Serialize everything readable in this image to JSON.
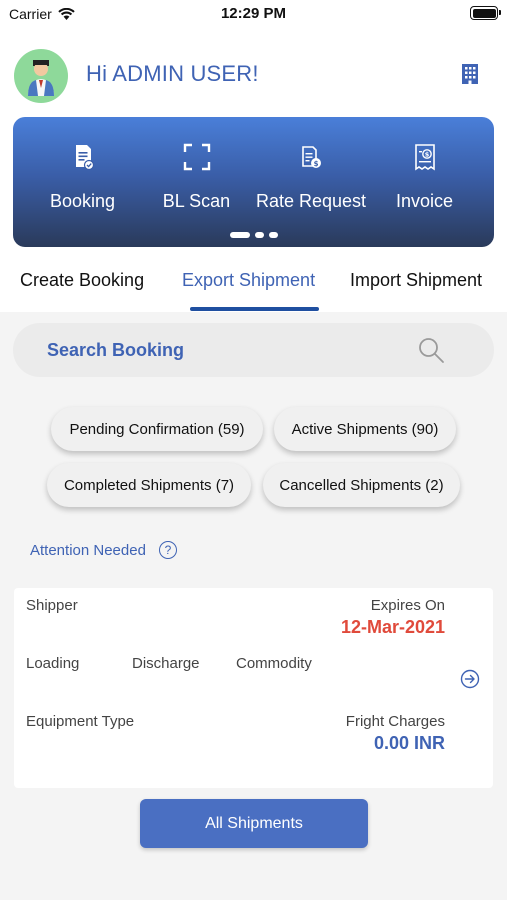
{
  "status_bar": {
    "carrier": "Carrier",
    "time": "12:29 PM"
  },
  "header": {
    "greeting": "Hi ADMIN USER!"
  },
  "quick_actions": [
    {
      "label": "Booking",
      "icon": "booking-document-icon"
    },
    {
      "label": "BL Scan",
      "icon": "scan-frame-icon"
    },
    {
      "label": "Rate Request",
      "icon": "rate-request-icon"
    },
    {
      "label": "Invoice",
      "icon": "invoice-icon"
    }
  ],
  "tabs": [
    {
      "label": "Create Booking",
      "active": false
    },
    {
      "label": "Export Shipment",
      "active": true
    },
    {
      "label": "Import Shipment",
      "active": false
    }
  ],
  "search": {
    "placeholder": "Search Booking"
  },
  "filters": [
    "Pending Confirmation (59)",
    "Active Shipments (90)",
    "Completed Shipments (7)",
    "Cancelled Shipments (2)"
  ],
  "attention": {
    "label": "Attention Needed",
    "help": "?"
  },
  "shipment_card": {
    "shipper_label": "Shipper",
    "expires_label": "Expires On",
    "expires_value": "12-Mar-2021",
    "loading_label": "Loading",
    "discharge_label": "Discharge",
    "commodity_label": "Commodity",
    "equipment_label": "Equipment Type",
    "charges_label": "Fright Charges",
    "charges_value": "0.00 INR"
  },
  "all_shipments_button": "All Shipments",
  "colors": {
    "accent": "#3f63b4",
    "alert": "#e04a3b",
    "button": "#4a6fc2"
  }
}
